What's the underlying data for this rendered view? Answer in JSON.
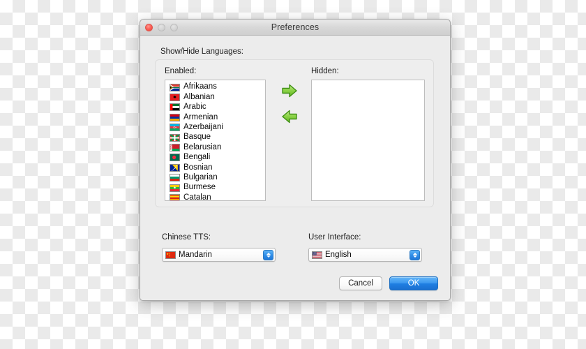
{
  "window": {
    "title": "Preferences",
    "traffic_lights": [
      "close",
      "minimize",
      "maximize"
    ]
  },
  "section": {
    "label": "Show/Hide Languages:",
    "enabled_label": "Enabled:",
    "hidden_label": "Hidden:"
  },
  "enabled_languages": [
    {
      "name": "Afrikaans",
      "flag": "south-africa"
    },
    {
      "name": "Albanian",
      "flag": "albania"
    },
    {
      "name": "Arabic",
      "flag": "uae"
    },
    {
      "name": "Armenian",
      "flag": "armenia"
    },
    {
      "name": "Azerbaijani",
      "flag": "azerbaijan"
    },
    {
      "name": "Basque",
      "flag": "basque"
    },
    {
      "name": "Belarusian",
      "flag": "belarus"
    },
    {
      "name": "Bengali",
      "flag": "bangladesh"
    },
    {
      "name": "Bosnian",
      "flag": "bosnia"
    },
    {
      "name": "Bulgarian",
      "flag": "bulgaria"
    },
    {
      "name": "Burmese",
      "flag": "myanmar"
    },
    {
      "name": "Catalan",
      "flag": "catalonia"
    }
  ],
  "hidden_languages": [],
  "arrows": {
    "move_right": "arrow-right-icon",
    "move_left": "arrow-left-icon"
  },
  "fields": {
    "tts": {
      "label": "Chinese TTS:",
      "value": "Mandarin",
      "flag": "china"
    },
    "ui": {
      "label": "User Interface:",
      "value": "English",
      "flag": "usa"
    }
  },
  "buttons": {
    "cancel": "Cancel",
    "ok": "OK"
  },
  "colors": {
    "accent_blue": "#2f8ee8",
    "default_button": "#1f7fe2",
    "arrow_green": "#7ec832",
    "window_bg": "#ececec",
    "close_red": "#fc6058"
  }
}
